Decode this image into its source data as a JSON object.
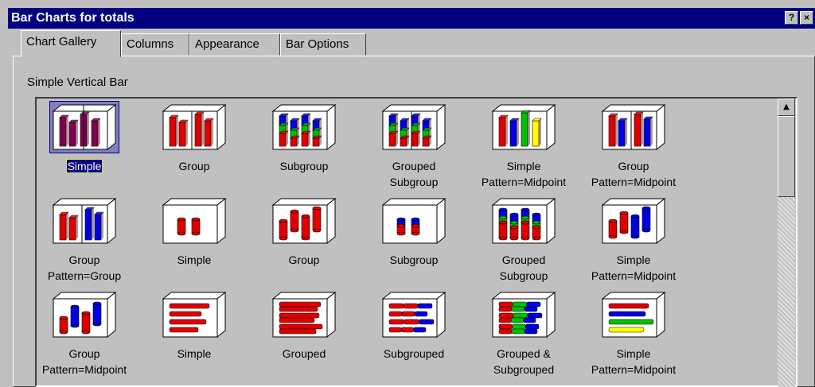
{
  "window": {
    "title": "Bar Charts for totals",
    "help_label": "?",
    "close_label": "×"
  },
  "tabs": [
    {
      "label": "Chart Gallery",
      "active": true
    },
    {
      "label": "Columns",
      "active": false
    },
    {
      "label": "Appearance",
      "active": false
    },
    {
      "label": "Bar Options",
      "active": false
    }
  ],
  "gallery": {
    "section_label": "Simple Vertical Bar",
    "items": [
      {
        "label": "Simple",
        "icon": "vbar-simple",
        "selected": true
      },
      {
        "label": "Group",
        "icon": "vbar-group"
      },
      {
        "label": "Subgroup",
        "icon": "vbar-subgroup"
      },
      {
        "label": "Grouped\nSubgroup",
        "icon": "vbar-grouped-subgroup"
      },
      {
        "label": "Simple\nPattern=Midpoint",
        "icon": "vbar-simple-midpoint"
      },
      {
        "label": "Group\nPattern=Midpoint",
        "icon": "vbar-group-midpoint"
      },
      {
        "label": "Group\nPattern=Group",
        "icon": "vbar-group-pattern"
      },
      {
        "label": "Simple",
        "icon": "cyl-simple"
      },
      {
        "label": "Group",
        "icon": "cyl-group"
      },
      {
        "label": "Subgroup",
        "icon": "cyl-subgroup"
      },
      {
        "label": "Grouped\nSubgroup",
        "icon": "cyl-grouped-subgroup"
      },
      {
        "label": "Simple\nPattern=Midpoint",
        "icon": "cyl-simple-midpoint"
      },
      {
        "label": "Group\nPattern=Midpoint",
        "icon": "cyl-group-midpoint"
      },
      {
        "label": "Simple",
        "icon": "hbar-simple"
      },
      {
        "label": "Grouped",
        "icon": "hbar-grouped"
      },
      {
        "label": "Subgrouped",
        "icon": "hbar-subgrouped"
      },
      {
        "label": "Grouped &\nSubgrouped",
        "icon": "hbar-grouped-subgrouped"
      },
      {
        "label": "Simple\nPattern=Midpoint",
        "icon": "hbar-simple-midpoint"
      }
    ]
  },
  "colors": {
    "red": "#e00000",
    "blue": "#0000e0",
    "green": "#00c000",
    "yellow": "#ffff00",
    "purple": "#800050"
  }
}
